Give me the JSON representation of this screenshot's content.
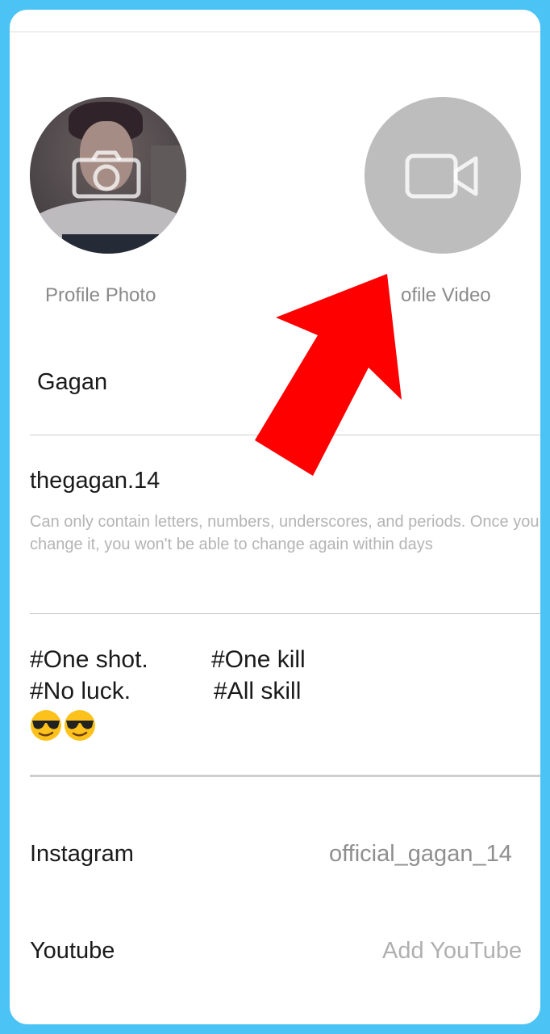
{
  "profile": {
    "photo_label": "Profile Photo",
    "video_label": "ofile Video",
    "name": "Gagan",
    "username": "thegagan.14",
    "username_hint": "Can only contain letters, numbers, underscores, and periods. Once you change it, you won't be able to change again within days",
    "bio_line1_a": "#One shot.",
    "bio_line1_b": "#One kill",
    "bio_line2_a": "#No luck.",
    "bio_line2_b": "#All skill",
    "bio_emoji": [
      "sunglasses-emoji",
      "sunglasses-emoji"
    ]
  },
  "links": {
    "instagram_label": "Instagram",
    "instagram_value": "official_gagan_14",
    "youtube_label": "Youtube",
    "youtube_placeholder": "Add YouTube"
  },
  "colors": {
    "frame": "#4cc3f5",
    "arrow": "#ff0000",
    "video_placeholder": "#bdbdbd"
  },
  "icons": {
    "photo_overlay": "camera-icon",
    "video_overlay": "video-camera-icon",
    "annotation": "red-arrow"
  }
}
